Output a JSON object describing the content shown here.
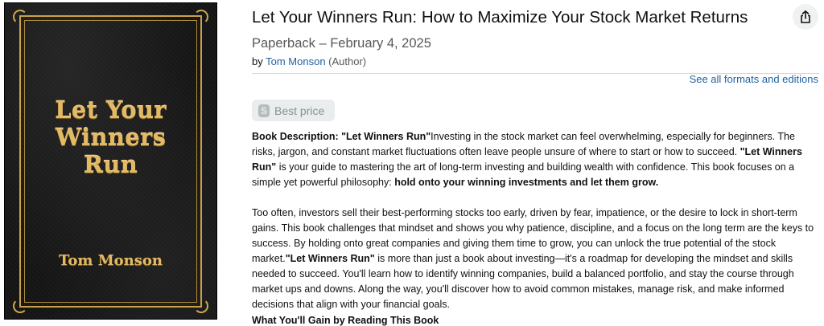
{
  "cover": {
    "title_lines": [
      "Let Your",
      "Winners",
      "Run"
    ],
    "author": "Tom Monson"
  },
  "product": {
    "title": "Let Your Winners Run: How to Maximize Your Stock Market Returns",
    "format": "Paperback – February 4, 2025",
    "by_prefix": "by",
    "author": "Tom Monson",
    "author_role": "(Author)",
    "see_all_formats": "See all formats and editions",
    "share_icon": "share-icon"
  },
  "best_price": {
    "icon_letter": "S",
    "label": "Best price"
  },
  "description": {
    "p1_lead": "Book Description: \"Let Winners Run\"",
    "p1_text1": "Investing in the stock market can feel overwhelming, especially for beginners. The risks, jargon, and constant market fluctuations often leave people unsure of where to start or how to succeed. ",
    "p1_bold2": "\"Let Winners Run\"",
    "p1_text2": " is your guide to mastering the art of long-term investing and building wealth with confidence. This book focuses on a simple yet powerful philosophy: ",
    "p1_bold3": "hold onto your winning investments and let them grow.",
    "p2_text1": "Too often, investors sell their best-performing stocks too early, driven by fear, impatience, or the desire to lock in short-term gains. This book challenges that mindset and shows you why patience, discipline, and a focus on the long term are the keys to success. By holding onto great companies and giving them time to grow, you can unlock the true potential of the stock market.",
    "p2_bold": "\"Let Winners Run\"",
    "p2_text2": " is more than just a book about investing—it's a roadmap for developing the mindset and skills needed to succeed. You'll learn how to identify winning companies, build a balanced portfolio, and stay the course through market ups and downs. Along the way, you'll discover how to avoid common mistakes, manage risk, and make informed decisions that align with your financial goals.",
    "gain_heading": "What You'll Gain by Reading This Book"
  }
}
